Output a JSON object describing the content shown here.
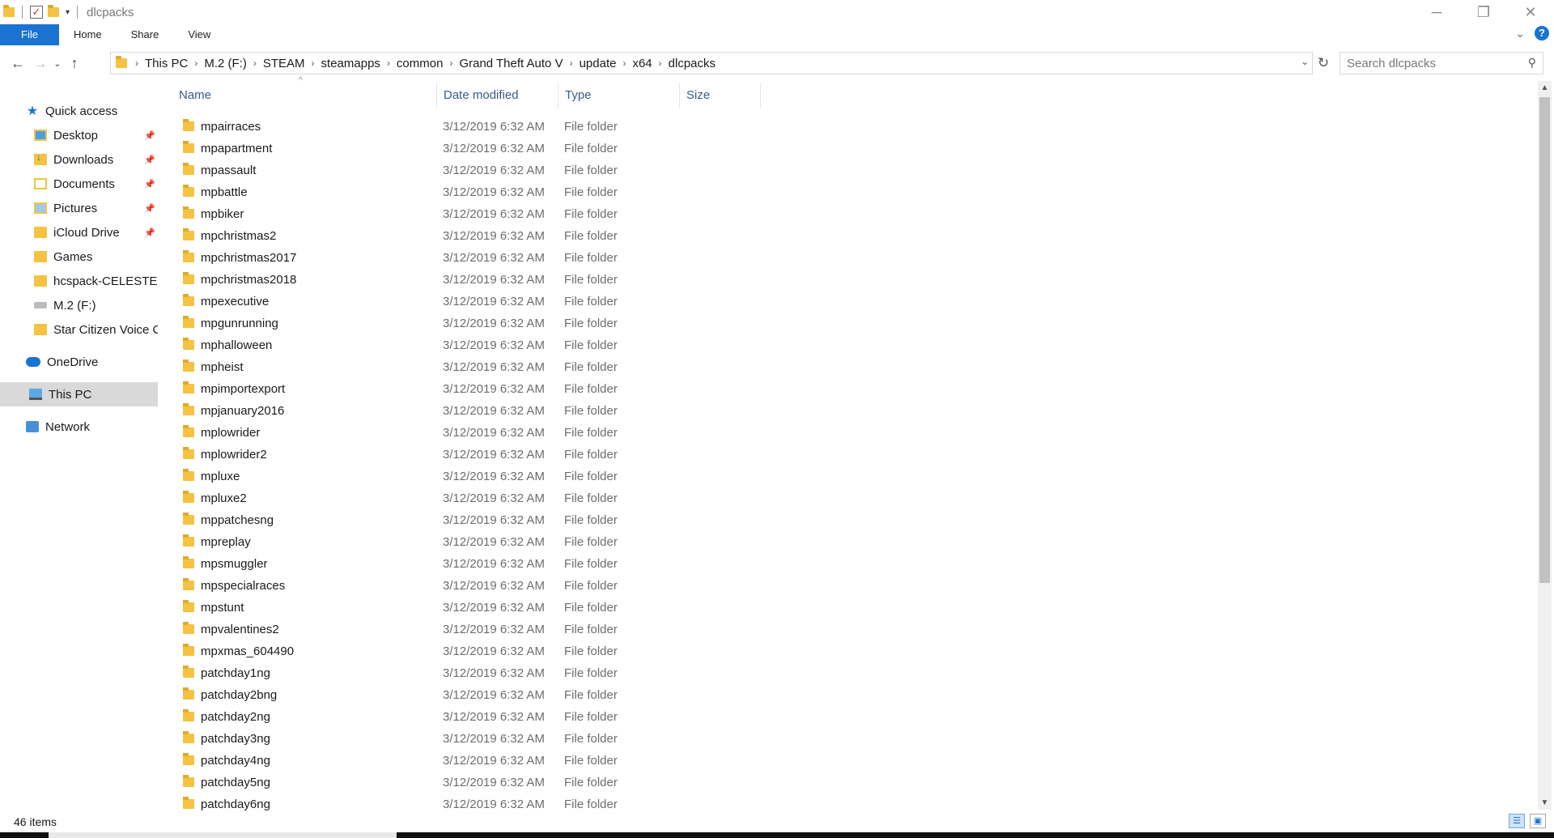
{
  "window": {
    "title": "dlcpacks"
  },
  "ribbon": {
    "tabs": [
      "File",
      "Home",
      "Share",
      "View"
    ]
  },
  "address": {
    "breadcrumbs": [
      "This PC",
      "M.2 (F:)",
      "STEAM",
      "steamapps",
      "common",
      "Grand Theft Auto V",
      "update",
      "x64",
      "dlcpacks"
    ]
  },
  "search": {
    "placeholder": "Search dlcpacks"
  },
  "sidebar": {
    "quick_access": "Quick access",
    "items": [
      {
        "label": "Desktop",
        "icon": "desktop-icon",
        "pinned": true
      },
      {
        "label": "Downloads",
        "icon": "downloads-icon",
        "pinned": true
      },
      {
        "label": "Documents",
        "icon": "documents-icon",
        "pinned": true
      },
      {
        "label": "Pictures",
        "icon": "pictures-icon",
        "pinned": true
      },
      {
        "label": "iCloud Drive",
        "icon": "folder-icon",
        "pinned": true
      },
      {
        "label": "Games",
        "icon": "games-folder-icon",
        "pinned": false
      },
      {
        "label": "hcspack-CELESTE",
        "icon": "folder-icon",
        "pinned": false
      },
      {
        "label": "M.2 (F:)",
        "icon": "drive-icon",
        "pinned": false
      },
      {
        "label": "Star Citizen Voice Co",
        "icon": "folder-icon",
        "pinned": false
      }
    ],
    "onedrive": "OneDrive",
    "this_pc": "This PC",
    "network": "Network"
  },
  "columns": {
    "name": "Name",
    "date_modified": "Date modified",
    "type": "Type",
    "size": "Size"
  },
  "files": [
    {
      "name": "mpairraces",
      "date": "3/12/2019 6:32 AM",
      "type": "File folder"
    },
    {
      "name": "mpapartment",
      "date": "3/12/2019 6:32 AM",
      "type": "File folder"
    },
    {
      "name": "mpassault",
      "date": "3/12/2019 6:32 AM",
      "type": "File folder"
    },
    {
      "name": "mpbattle",
      "date": "3/12/2019 6:32 AM",
      "type": "File folder"
    },
    {
      "name": "mpbiker",
      "date": "3/12/2019 6:32 AM",
      "type": "File folder"
    },
    {
      "name": "mpchristmas2",
      "date": "3/12/2019 6:32 AM",
      "type": "File folder"
    },
    {
      "name": "mpchristmas2017",
      "date": "3/12/2019 6:32 AM",
      "type": "File folder"
    },
    {
      "name": "mpchristmas2018",
      "date": "3/12/2019 6:32 AM",
      "type": "File folder"
    },
    {
      "name": "mpexecutive",
      "date": "3/12/2019 6:32 AM",
      "type": "File folder"
    },
    {
      "name": "mpgunrunning",
      "date": "3/12/2019 6:32 AM",
      "type": "File folder"
    },
    {
      "name": "mphalloween",
      "date": "3/12/2019 6:32 AM",
      "type": "File folder"
    },
    {
      "name": "mpheist",
      "date": "3/12/2019 6:32 AM",
      "type": "File folder"
    },
    {
      "name": "mpimportexport",
      "date": "3/12/2019 6:32 AM",
      "type": "File folder"
    },
    {
      "name": "mpjanuary2016",
      "date": "3/12/2019 6:32 AM",
      "type": "File folder"
    },
    {
      "name": "mplowrider",
      "date": "3/12/2019 6:32 AM",
      "type": "File folder"
    },
    {
      "name": "mplowrider2",
      "date": "3/12/2019 6:32 AM",
      "type": "File folder"
    },
    {
      "name": "mpluxe",
      "date": "3/12/2019 6:32 AM",
      "type": "File folder"
    },
    {
      "name": "mpluxe2",
      "date": "3/12/2019 6:32 AM",
      "type": "File folder"
    },
    {
      "name": "mppatchesng",
      "date": "3/12/2019 6:32 AM",
      "type": "File folder"
    },
    {
      "name": "mpreplay",
      "date": "3/12/2019 6:32 AM",
      "type": "File folder"
    },
    {
      "name": "mpsmuggler",
      "date": "3/12/2019 6:32 AM",
      "type": "File folder"
    },
    {
      "name": "mpspecialraces",
      "date": "3/12/2019 6:32 AM",
      "type": "File folder"
    },
    {
      "name": "mpstunt",
      "date": "3/12/2019 6:32 AM",
      "type": "File folder"
    },
    {
      "name": "mpvalentines2",
      "date": "3/12/2019 6:32 AM",
      "type": "File folder"
    },
    {
      "name": "mpxmas_604490",
      "date": "3/12/2019 6:32 AM",
      "type": "File folder"
    },
    {
      "name": "patchday1ng",
      "date": "3/12/2019 6:32 AM",
      "type": "File folder"
    },
    {
      "name": "patchday2bng",
      "date": "3/12/2019 6:32 AM",
      "type": "File folder"
    },
    {
      "name": "patchday2ng",
      "date": "3/12/2019 6:32 AM",
      "type": "File folder"
    },
    {
      "name": "patchday3ng",
      "date": "3/12/2019 6:32 AM",
      "type": "File folder"
    },
    {
      "name": "patchday4ng",
      "date": "3/12/2019 6:32 AM",
      "type": "File folder"
    },
    {
      "name": "patchday5ng",
      "date": "3/12/2019 6:32 AM",
      "type": "File folder"
    },
    {
      "name": "patchday6ng",
      "date": "3/12/2019 6:32 AM",
      "type": "File folder"
    }
  ],
  "status": {
    "item_count": "46 items"
  },
  "colors": {
    "accent": "#1a73d1",
    "folder": "#f5c242",
    "selected_nav": "#d9d9d9"
  }
}
